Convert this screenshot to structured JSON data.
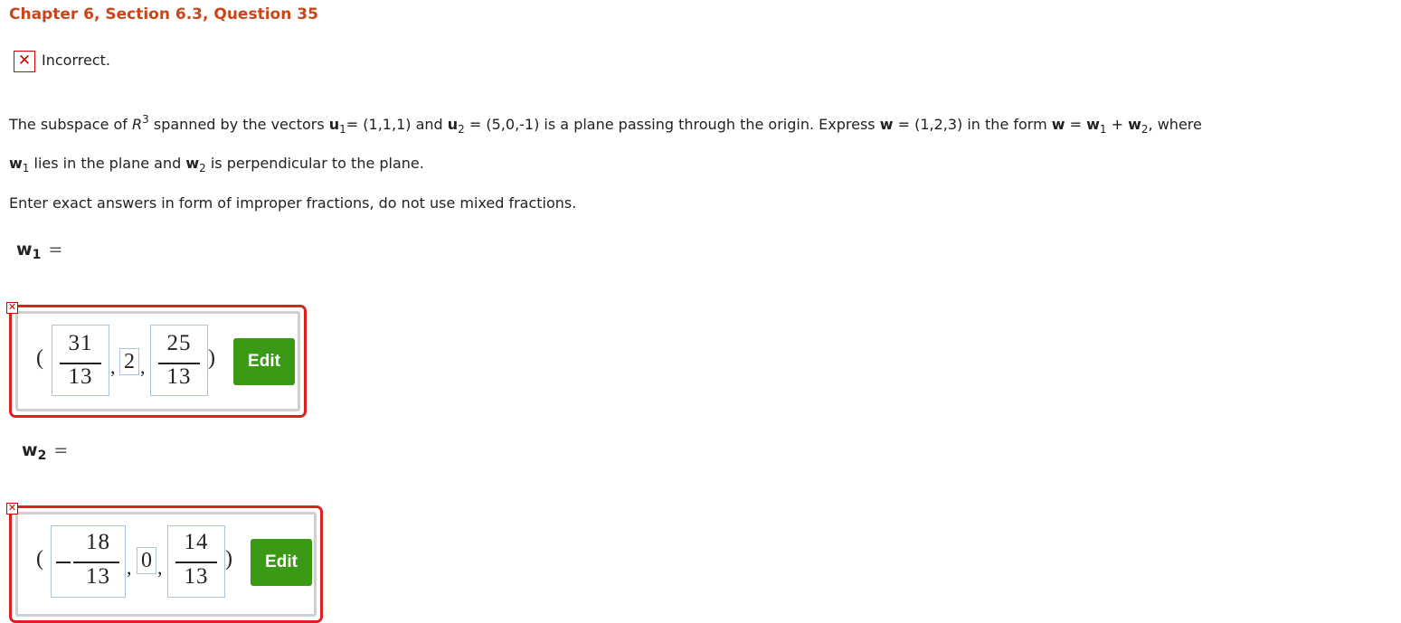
{
  "header": {
    "title": "Chapter 6, Section 6.3, Question 35"
  },
  "status": {
    "text": "Incorrect."
  },
  "question": {
    "line1": {
      "p1": "The subspace of ",
      "R": "R",
      "R_sup": "3",
      "p2": " spanned by the vectors ",
      "u": "u",
      "sub1": "1",
      "p3": "= (1,1,1) and ",
      "sub2": "2",
      "p4": " = (5,0,-1) is a plane passing through the origin. Express ",
      "w": "w",
      "p5": " = (1,2,3) in the form ",
      "p6": " = ",
      "p7": " + ",
      "p8": ", where"
    },
    "line2": {
      "p1": " lies in the plane and ",
      "p2": " is perpendicular to the plane."
    },
    "line3": "Enter exact answers in form of improper fractions, do not use mixed fractions."
  },
  "answers": {
    "w1": {
      "symbol": "w",
      "sub": "1",
      "equals": "=",
      "open_paren": "(",
      "close_paren": ")",
      "comma": ",",
      "c1_num": "31",
      "c1_den": "13",
      "c2": "2",
      "c3_num": "25",
      "c3_den": "13",
      "edit_label": "Edit"
    },
    "w2": {
      "symbol": "w",
      "sub": "2",
      "equals": "=",
      "open_paren": "(",
      "close_paren": ")",
      "comma": ",",
      "c1_num": "18",
      "c1_den": "13",
      "c2": "0",
      "c3_num": "14",
      "c3_den": "13",
      "edit_label": "Edit"
    }
  },
  "icons": {
    "incorrect": "✕"
  },
  "colors": {
    "title": "#c8461a",
    "error": "#d40000",
    "edit_button": "#3a9a16",
    "input_border": "#a9c4dd"
  }
}
